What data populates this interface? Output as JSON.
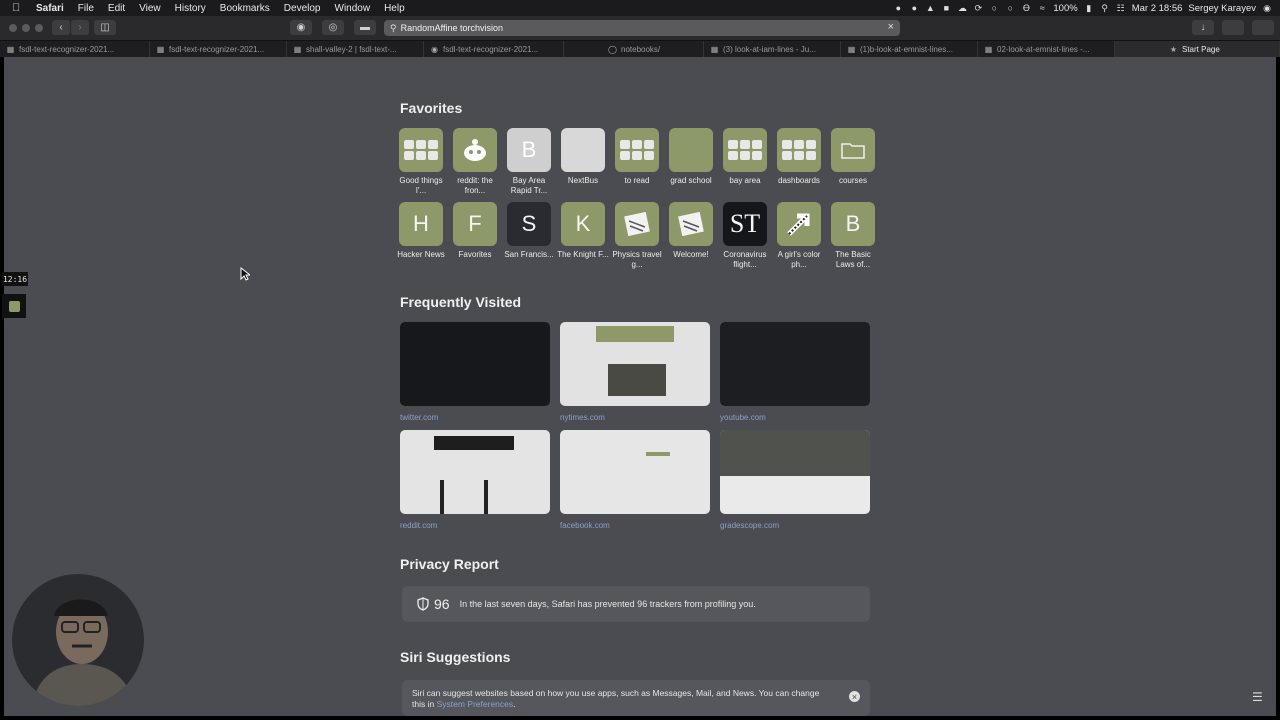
{
  "menubar": {
    "app": "Safari",
    "items": [
      "File",
      "Edit",
      "View",
      "History",
      "Bookmarks",
      "Develop",
      "Window",
      "Help"
    ],
    "battery": "100%",
    "datetime": "Mar 2  18:56",
    "user": "Sergey Karayev"
  },
  "toolbar": {
    "url": "RandomAffine torchvision"
  },
  "tabs": [
    "fsdl-text-recognizer-2021...",
    "fsdl-text-recognizer-2021...",
    "shall-valley-2 | fsdl-text-...",
    "fsdl-text-recognizer-2021...",
    "notebooks/",
    "(3) look-at-iam-lines - Ju...",
    "(1)b-look-at-emnist-lines...",
    "02-look-at-emnist-lines -...",
    "Start Page"
  ],
  "favorites": {
    "title": "Favorites",
    "items": [
      {
        "label": "Good things I'...",
        "letter": "",
        "style": "grid"
      },
      {
        "label": "reddit: the fron...",
        "letter": "",
        "style": "reddit"
      },
      {
        "label": "Bay Area Rapid Tr...",
        "letter": "B",
        "style": "grey"
      },
      {
        "label": "NextBus",
        "letter": "",
        "style": "grey"
      },
      {
        "label": "to read",
        "letter": "",
        "style": "grid"
      },
      {
        "label": "grad school",
        "letter": "",
        "style": "plain"
      },
      {
        "label": "bay area",
        "letter": "",
        "style": "grid"
      },
      {
        "label": "dashboards",
        "letter": "",
        "style": "grid"
      },
      {
        "label": "courses",
        "letter": "",
        "style": "folder"
      },
      {
        "label": "Hacker News",
        "letter": "H",
        "style": "plain"
      },
      {
        "label": "Favorites",
        "letter": "F",
        "style": "plain"
      },
      {
        "label": "San Francis...",
        "letter": "S",
        "style": "dark"
      },
      {
        "label": "The Knight F...",
        "letter": "K",
        "style": "plain"
      },
      {
        "label": "Physics travel g...",
        "letter": "",
        "style": "paper"
      },
      {
        "label": "Welcome!",
        "letter": "",
        "style": "paper"
      },
      {
        "label": "Coronavirus flight...",
        "letter": "ST",
        "style": "black"
      },
      {
        "label": "A girl's color ph...",
        "letter": "",
        "style": "arrow"
      },
      {
        "label": "The Basic Laws of...",
        "letter": "B",
        "style": "plain"
      }
    ]
  },
  "frequently_visited": {
    "title": "Frequently Visited",
    "sites": [
      {
        "label": "twitter.com",
        "theme": "dark"
      },
      {
        "label": "nytimes.com",
        "theme": "light"
      },
      {
        "label": "youtube.com",
        "theme": "dark"
      },
      {
        "label": "reddit.com",
        "theme": "light"
      },
      {
        "label": "facebook.com",
        "theme": "light"
      },
      {
        "label": "gradescope.com",
        "theme": "light"
      }
    ]
  },
  "privacy": {
    "title": "Privacy Report",
    "count": "96",
    "text": "In the last seven days, Safari has prevented 96 trackers from profiling you."
  },
  "siri": {
    "title": "Siri Suggestions",
    "text": "Siri can suggest websites based on how you use apps, such as Messages, Mail, and News. You can change this in",
    "link": "System Preferences",
    "tail": "."
  },
  "overlay": {
    "clock": "12:16"
  },
  "colors": {
    "page_bg": "#4b4c51",
    "tile_green": "#8d9968",
    "link_blue": "#8ba0c9"
  }
}
